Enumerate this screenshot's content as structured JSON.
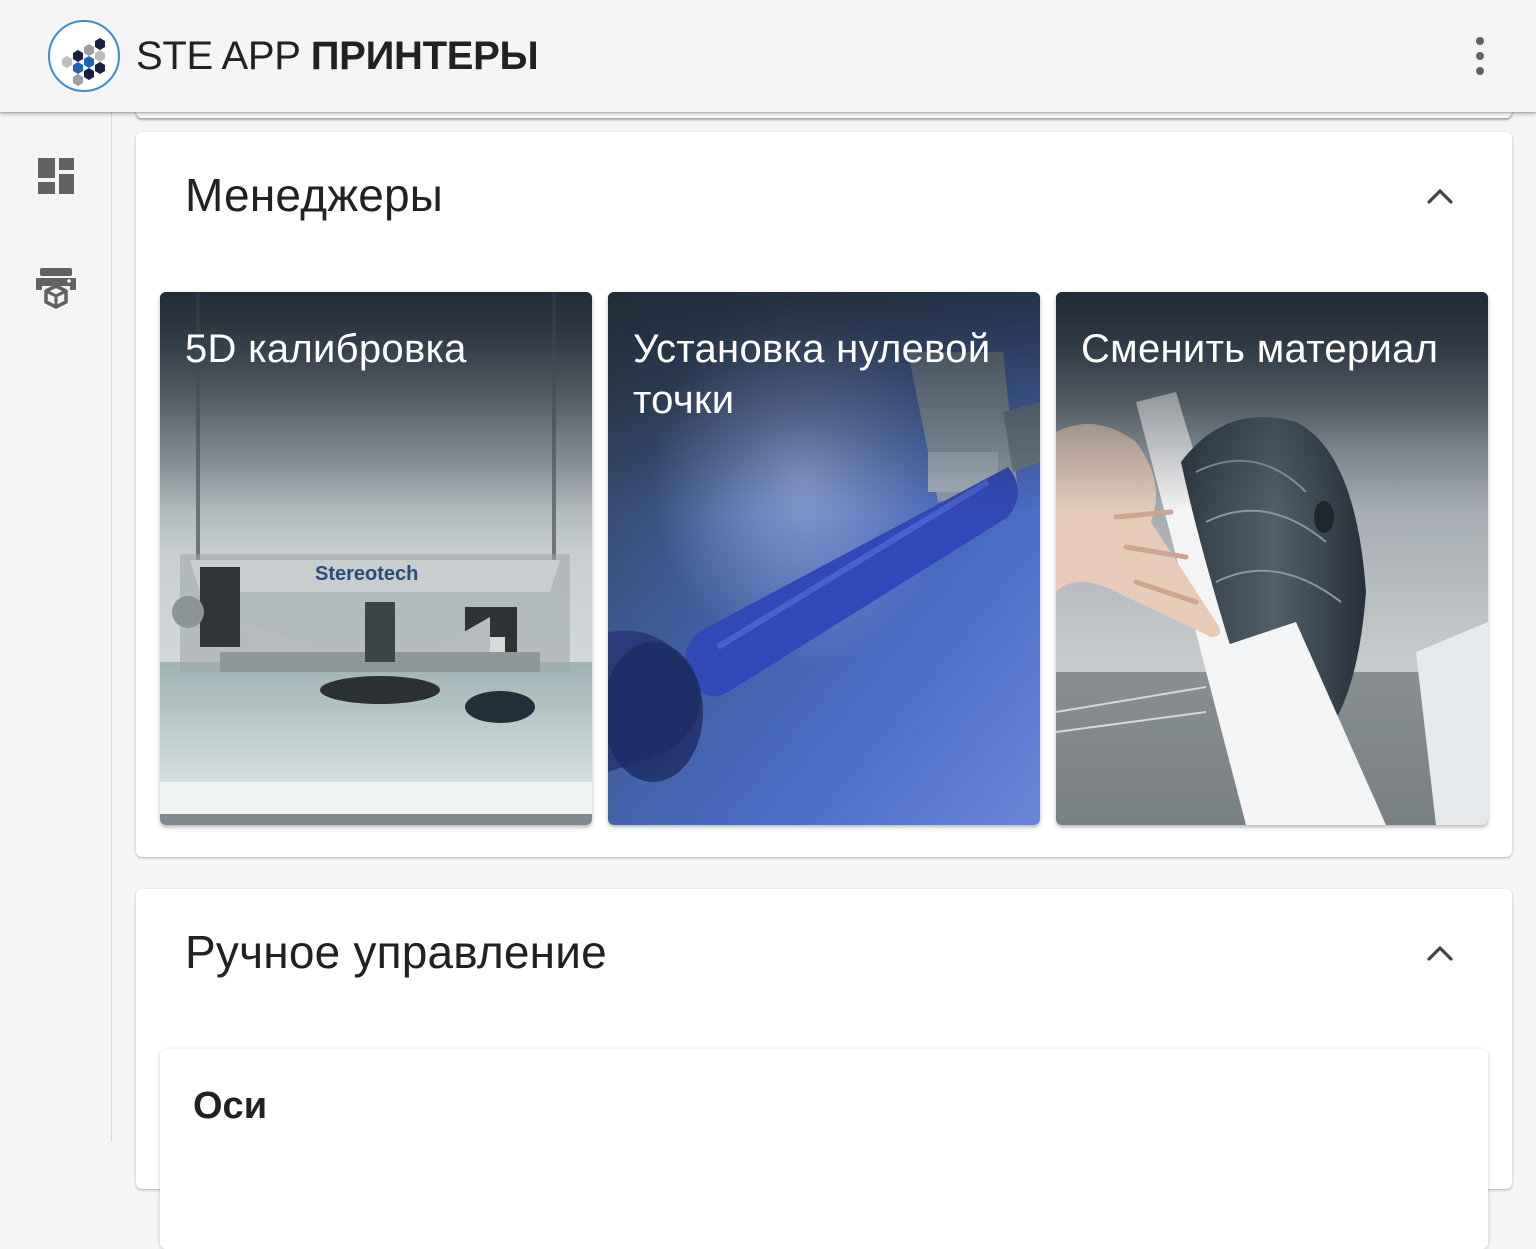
{
  "app_bar": {
    "title_regular": "STE APP ",
    "title_bold": "ПРИНТЕРЫ",
    "logo_icon": "hexagon-cluster-logo",
    "menu_icon": "more-vert-icon"
  },
  "sidebar": {
    "items": [
      {
        "icon": "dashboard-icon"
      },
      {
        "icon": "printer-cube-icon"
      }
    ]
  },
  "managers": {
    "title": "Менеджеры",
    "collapse_icon": "chevron-up-icon",
    "tiles": [
      {
        "label": "5D калибровка",
        "image": "printer-stage-photo"
      },
      {
        "label": "Установка нулевой точки",
        "image": "nozzle-blue-photo"
      },
      {
        "label": "Сменить материал",
        "image": "filament-spool-photo"
      }
    ]
  },
  "manual": {
    "title": "Ручное управление",
    "collapse_icon": "chevron-up-icon",
    "axes_title": "Оси"
  },
  "colors": {
    "background": "#f5f5f5",
    "card": "#ffffff",
    "logo_ring": "#3a8dc9",
    "icon_grey": "#616161",
    "tile_overlay": "#1f2a36"
  }
}
